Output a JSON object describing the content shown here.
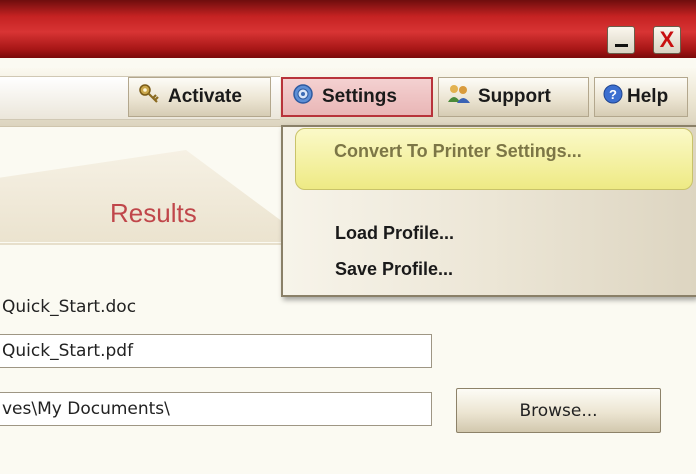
{
  "window": {
    "minimize_icon": "minimize-icon",
    "close_icon": "close-icon",
    "close_glyph": "X"
  },
  "toolbar": {
    "activate_label": "Activate",
    "activate_icon": "key-icon",
    "settings_label": "Settings",
    "settings_icon": "gear-icon",
    "support_label": "Support",
    "support_icon": "people-icon",
    "help_label": "Help",
    "help_icon": "help-icon"
  },
  "settings_menu": {
    "items": [
      {
        "label": "Convert To Printer Settings...",
        "highlighted": true
      },
      {
        "label": "Load Profile..."
      },
      {
        "label": "Save Profile..."
      }
    ]
  },
  "results": {
    "tab_label": "Results"
  },
  "files": {
    "source_label": "Quick_Start.doc",
    "output_value": "Quick_Start.pdf",
    "folder_value": "ves\\My Documents\\",
    "browse_label": "Browse..."
  },
  "colors": {
    "title_red": "#c52222",
    "results_text": "#c0464a",
    "menu_highlight": "#eeea84"
  }
}
